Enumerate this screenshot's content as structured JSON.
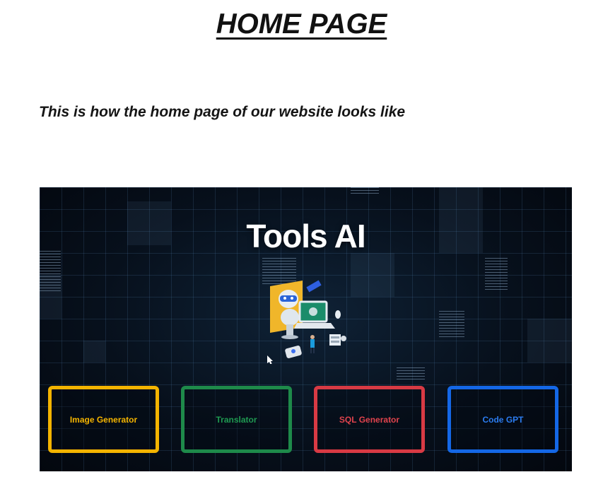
{
  "document": {
    "title": "HOME PAGE",
    "subtitle": "This is how the home page of our website looks like"
  },
  "screenshot": {
    "hero_title": "Tools AI",
    "illustration_icon": "robot-laptop-icon",
    "tools": [
      {
        "label": "Image Generator",
        "color": "#f4b400"
      },
      {
        "label": "Translator",
        "color": "#1e8a4a"
      },
      {
        "label": "SQL Generator",
        "color": "#d83a44"
      },
      {
        "label": "Code GPT",
        "color": "#1467e6"
      }
    ],
    "background_color": "#07101c"
  }
}
